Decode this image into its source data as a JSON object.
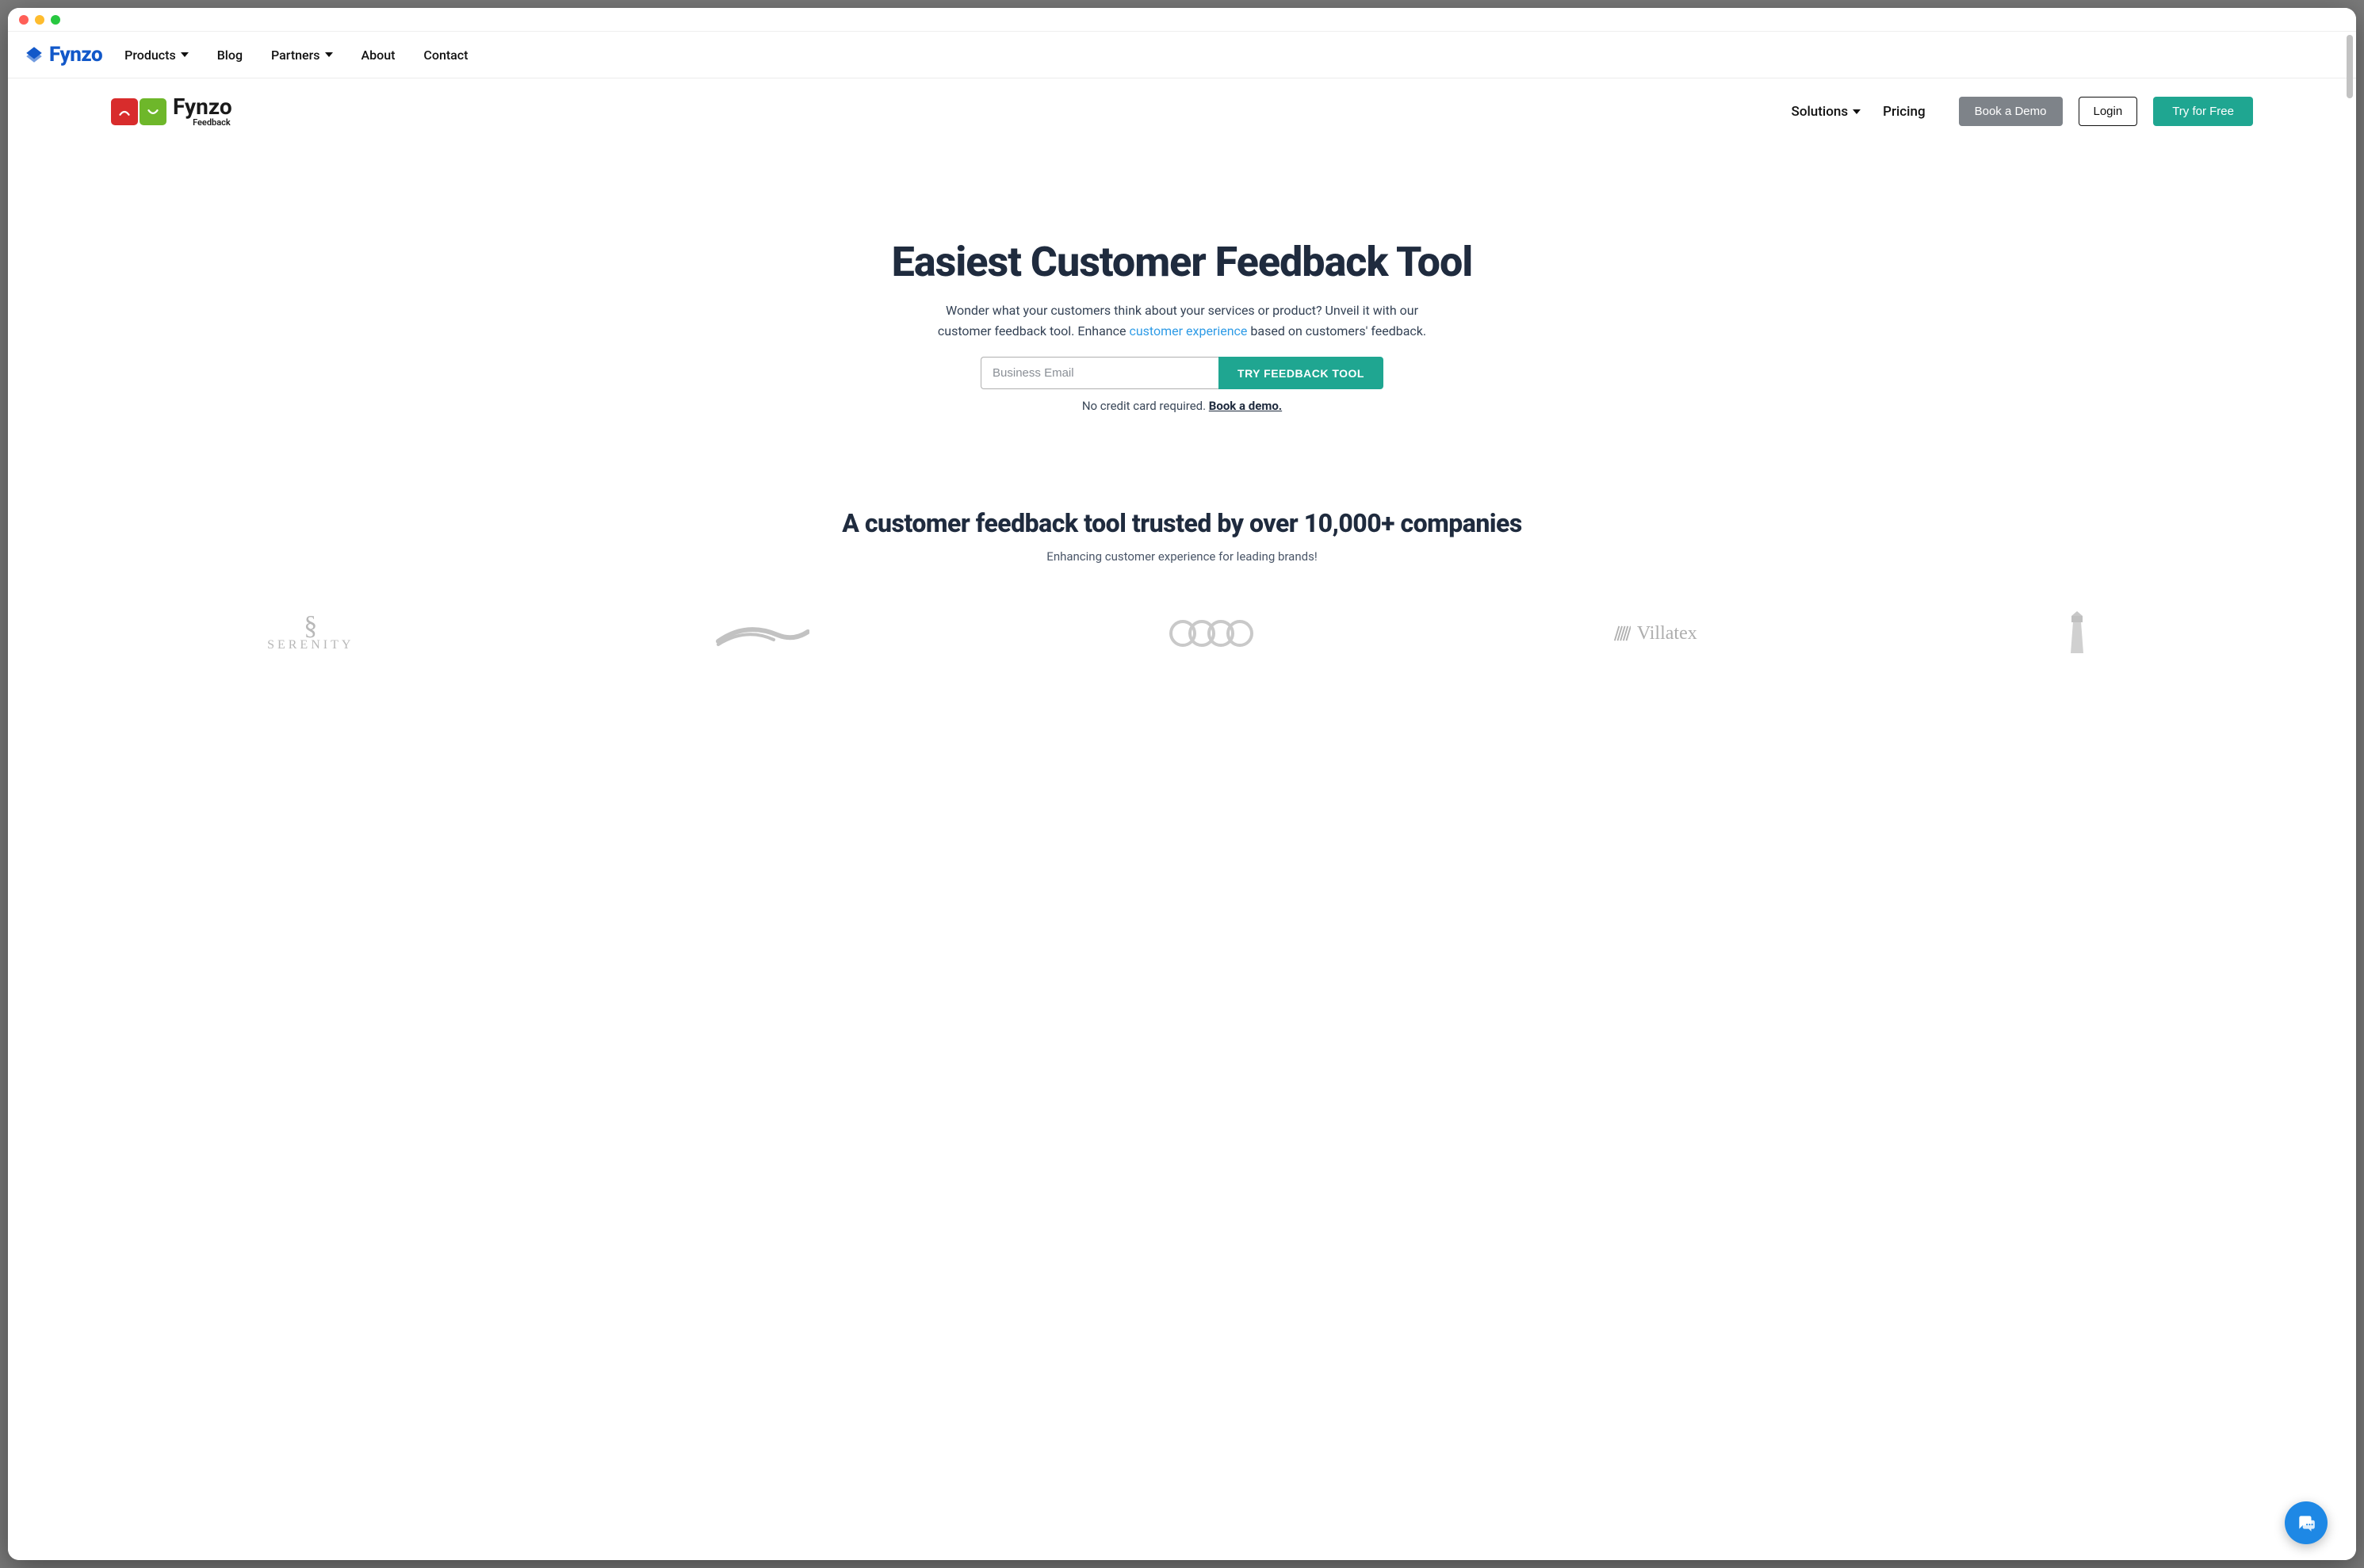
{
  "top_nav": {
    "brand": "Fynzo",
    "items": [
      "Products",
      "Blog",
      "Partners",
      "About",
      "Contact"
    ],
    "dropdown_flags": [
      true,
      false,
      true,
      false,
      false
    ]
  },
  "secondary_nav": {
    "product_name": "Fynzo",
    "product_sub": "Feedback",
    "menu": [
      "Solutions",
      "Pricing"
    ],
    "menu_dropdown_flags": [
      true,
      false
    ],
    "demo_label": "Book a Demo",
    "login_label": "Login",
    "try_label": "Try for Free"
  },
  "hero": {
    "headline": "Easiest Customer Feedback Tool",
    "sub_before": "Wonder what your customers think about your services or product? Unveil it with our customer feedback tool. Enhance ",
    "sub_link": "customer experience",
    "sub_after": " based on customers' feedback.",
    "email_placeholder": "Business Email",
    "submit_label": "TRY FEEDBACK TOOL",
    "note_text": "No credit card required. ",
    "note_link": "Book a demo."
  },
  "trusted": {
    "headline": "A customer feedback tool trusted by over 10,000+ companies",
    "sub": "Enhancing customer experience for leading brands!",
    "logos": [
      "SERENITY",
      "wave",
      "rings",
      "Villatex",
      "lighthouse"
    ]
  },
  "colors": {
    "brand_blue": "#1258c9",
    "teal": "#1fa691",
    "dark": "#1f2b3e",
    "gray_btn": "#7e8389"
  }
}
